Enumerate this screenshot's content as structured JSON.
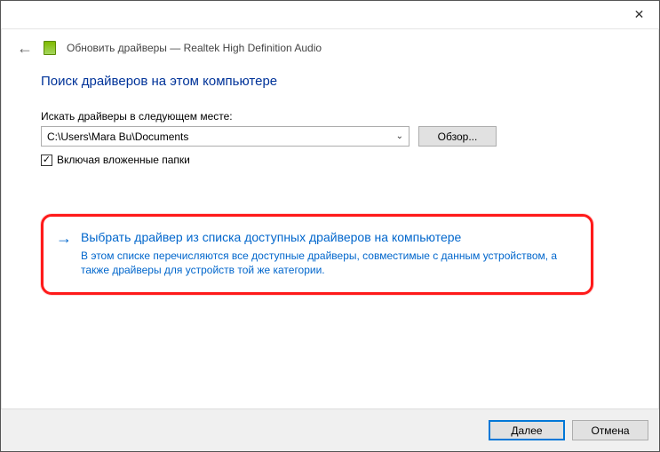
{
  "titlebar": {
    "close_label": "✕"
  },
  "breadcrumb": {
    "text": "Обновить драйверы — Realtek High Definition Audio"
  },
  "heading": "Поиск драйверов на этом компьютере",
  "search_in": {
    "label": "Искать драйверы в следующем месте:",
    "path": "C:\\Users\\Mara Bu\\Documents",
    "browse_label": "Обзор..."
  },
  "include_sub": {
    "label": "Включая вложенные папки",
    "checked": true
  },
  "option": {
    "title": "Выбрать драйвер из списка доступных драйверов на компьютере",
    "description": "В этом списке перечисляются все доступные драйверы, совместимые с данным устройством, а также драйверы для устройств той же категории."
  },
  "footer": {
    "next_label": "Далее",
    "cancel_label": "Отмена"
  }
}
